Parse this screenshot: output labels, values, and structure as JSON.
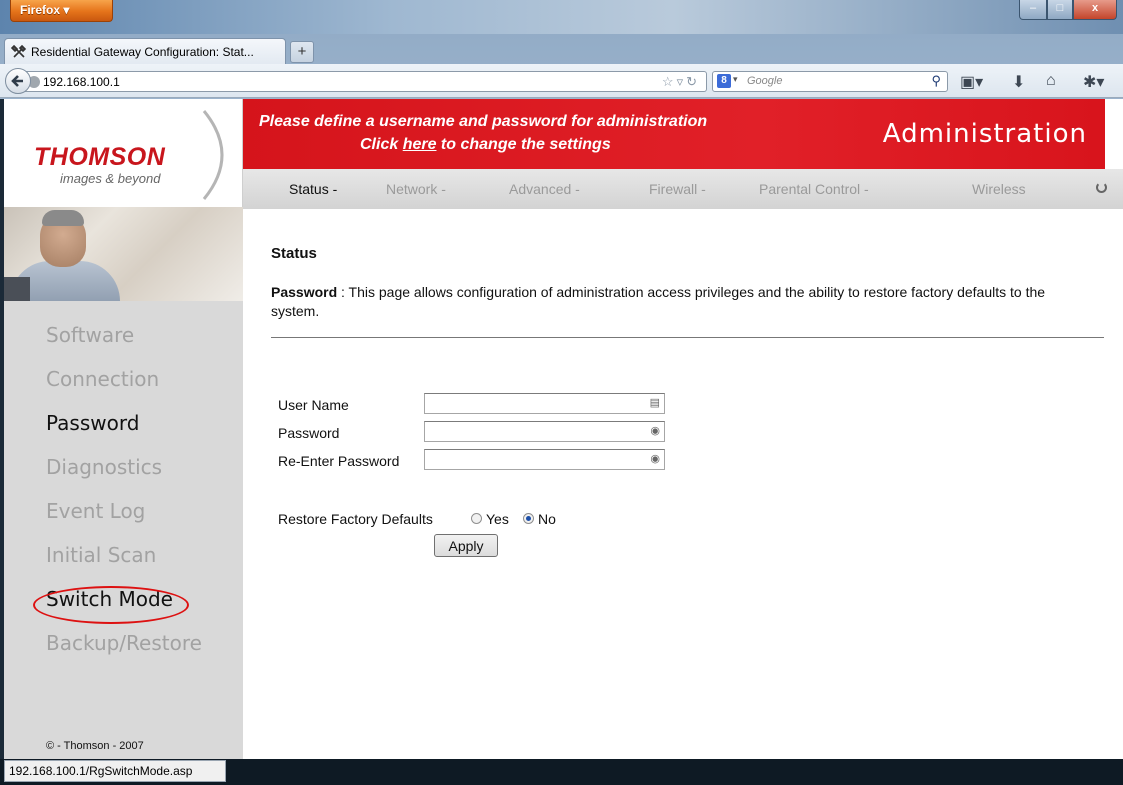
{
  "browser": {
    "app_button": "Firefox",
    "tab_title": "Residential Gateway Configuration: Stat...",
    "url": "192.168.100.1",
    "search_placeholder": "Google",
    "status_url": "192.168.100.1/RgSwitchMode.asp",
    "window_controls": {
      "minimize": "–",
      "maximize": "□",
      "close": "x"
    }
  },
  "brand": {
    "logo": "THOMSON",
    "tagline": "images & beyond",
    "color": "#c8161d"
  },
  "banner": {
    "line1": "Please define a username and password for administration",
    "line2_prefix": "Click ",
    "line2_link": "here",
    "line2_suffix": " to change the settings",
    "section_title": "Administration",
    "color": "#d5141b"
  },
  "top_nav": [
    "Status -",
    "Network -",
    "Advanced -",
    "Firewall -",
    "Parental Control -",
    "Wireless"
  ],
  "side_menu": [
    "Software",
    "Connection",
    "Password",
    "Diagnostics",
    "Event Log",
    "Initial Scan",
    "Switch Mode",
    "Backup/Restore"
  ],
  "copyright": "© - Thomson - 2007",
  "content": {
    "title": "Status",
    "desc_label": "Password",
    "desc_text": " : This page allows configuration of administration access privileges and the ability to restore factory defaults to the system.",
    "fields": {
      "username_label": "User Name",
      "password_label": "Password",
      "reenter_label": "Re-Enter Password"
    },
    "restore_label": "Restore Factory Defaults",
    "yes_label": "Yes",
    "no_label": "No",
    "apply_label": "Apply"
  }
}
